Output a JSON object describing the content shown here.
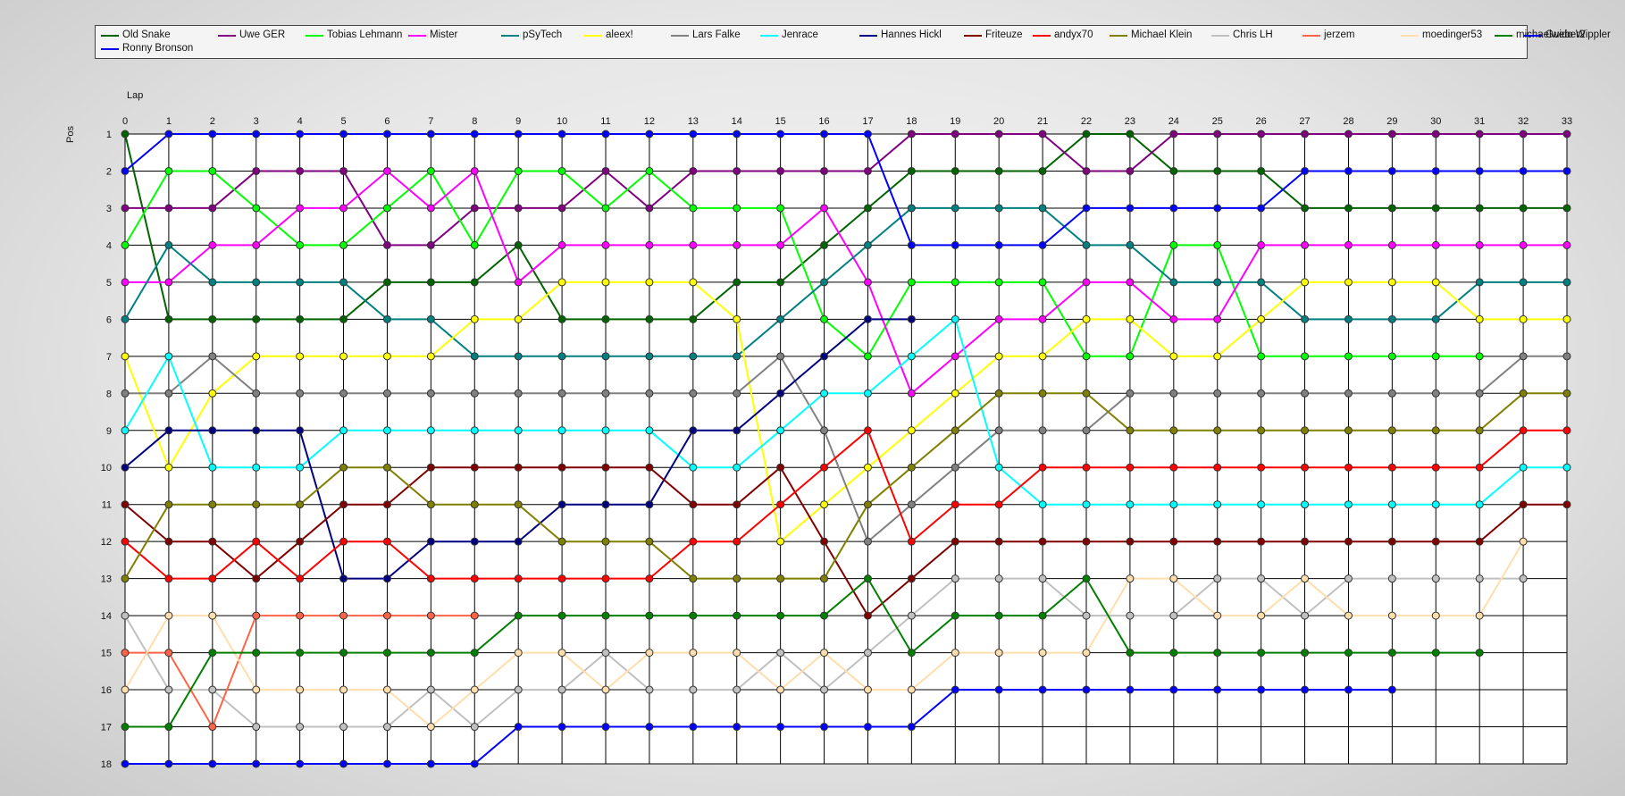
{
  "chart_data": {
    "type": "line",
    "xlabel": "Lap",
    "ylabel": "Pos",
    "x": [
      0,
      1,
      2,
      3,
      4,
      5,
      6,
      7,
      8,
      9,
      10,
      11,
      12,
      13,
      14,
      15,
      16,
      17,
      18,
      19,
      20,
      21,
      22,
      23,
      24,
      25,
      26,
      27,
      28,
      29,
      30,
      31,
      32,
      33
    ],
    "xlim": [
      0,
      33
    ],
    "ylim": [
      1,
      18
    ],
    "y_inverted": true,
    "grid": true,
    "legend_position": "top",
    "series": [
      {
        "name": "Old Snake",
        "color": "#006400",
        "values": [
          1,
          6,
          6,
          6,
          6,
          6,
          5,
          5,
          5,
          4,
          6,
          6,
          6,
          6,
          5,
          5,
          4,
          3,
          2,
          2,
          2,
          2,
          1,
          1,
          2,
          2,
          2,
          3,
          3,
          3,
          3,
          3,
          3,
          3
        ]
      },
      {
        "name": "Uwe GER",
        "color": "#800080",
        "values": [
          3,
          3,
          3,
          2,
          2,
          2,
          4,
          4,
          3,
          3,
          3,
          2,
          3,
          2,
          2,
          2,
          2,
          2,
          1,
          1,
          1,
          1,
          2,
          2,
          1,
          1,
          1,
          1,
          1,
          1,
          1,
          1,
          1,
          1
        ]
      },
      {
        "name": "Tobias Lehmann",
        "color": "#00ff00",
        "values": [
          4,
          2,
          2,
          3,
          4,
          4,
          3,
          2,
          4,
          2,
          2,
          3,
          2,
          3,
          3,
          3,
          6,
          7,
          5,
          5,
          5,
          5,
          7,
          7,
          4,
          4,
          7,
          7,
          7,
          7,
          7,
          7,
          null,
          null
        ]
      },
      {
        "name": "Mister",
        "color": "#ff00ff",
        "values": [
          5,
          5,
          4,
          4,
          3,
          3,
          2,
          3,
          2,
          5,
          4,
          4,
          4,
          4,
          4,
          4,
          3,
          5,
          8,
          7,
          6,
          6,
          5,
          5,
          6,
          6,
          4,
          4,
          4,
          4,
          4,
          4,
          4,
          4
        ]
      },
      {
        "name": "pSyTech",
        "color": "#008080",
        "values": [
          6,
          4,
          5,
          5,
          5,
          5,
          6,
          6,
          7,
          7,
          7,
          7,
          7,
          7,
          7,
          6,
          5,
          4,
          3,
          3,
          3,
          3,
          4,
          4,
          5,
          5,
          5,
          6,
          6,
          6,
          6,
          5,
          5,
          5
        ]
      },
      {
        "name": "aleex!",
        "color": "#ffff00",
        "values": [
          7,
          10,
          8,
          7,
          7,
          7,
          7,
          7,
          6,
          6,
          5,
          5,
          5,
          5,
          6,
          12,
          11,
          10,
          9,
          8,
          7,
          7,
          6,
          6,
          7,
          7,
          6,
          5,
          5,
          5,
          5,
          6,
          6,
          6
        ]
      },
      {
        "name": "Lars Falke",
        "color": "#808080",
        "values": [
          8,
          8,
          7,
          8,
          8,
          8,
          8,
          8,
          8,
          8,
          8,
          8,
          8,
          8,
          8,
          7,
          9,
          12,
          11,
          10,
          9,
          9,
          9,
          8,
          8,
          8,
          8,
          8,
          8,
          8,
          8,
          8,
          7,
          7
        ]
      },
      {
        "name": "Jenrace",
        "color": "#00ffff",
        "values": [
          9,
          7,
          10,
          10,
          10,
          9,
          9,
          9,
          9,
          9,
          9,
          9,
          9,
          10,
          10,
          9,
          8,
          8,
          7,
          6,
          10,
          11,
          11,
          11,
          11,
          11,
          11,
          11,
          11,
          11,
          11,
          11,
          10,
          10
        ]
      },
      {
        "name": "Hannes Hickl",
        "color": "#000080",
        "values": [
          10,
          9,
          9,
          9,
          9,
          13,
          13,
          12,
          12,
          12,
          11,
          11,
          11,
          9,
          9,
          8,
          7,
          6,
          6,
          null,
          null,
          null,
          null,
          null,
          null,
          null,
          null,
          null,
          null,
          null,
          null,
          null,
          null,
          null
        ]
      },
      {
        "name": "Friteuze",
        "color": "#800000",
        "values": [
          11,
          12,
          12,
          13,
          12,
          11,
          11,
          10,
          10,
          10,
          10,
          10,
          10,
          11,
          11,
          10,
          12,
          14,
          13,
          12,
          12,
          12,
          12,
          12,
          12,
          12,
          12,
          12,
          12,
          12,
          12,
          12,
          11,
          11
        ]
      },
      {
        "name": "andyx70",
        "color": "#ff0000",
        "values": [
          12,
          13,
          13,
          12,
          13,
          12,
          12,
          13,
          13,
          13,
          13,
          13,
          13,
          12,
          12,
          11,
          10,
          9,
          12,
          11,
          11,
          10,
          10,
          10,
          10,
          10,
          10,
          10,
          10,
          10,
          10,
          10,
          9,
          9
        ]
      },
      {
        "name": "Michael Klein",
        "color": "#808000",
        "values": [
          13,
          11,
          11,
          11,
          11,
          10,
          10,
          11,
          11,
          11,
          12,
          12,
          12,
          13,
          13,
          13,
          13,
          11,
          10,
          9,
          8,
          8,
          8,
          9,
          9,
          9,
          9,
          9,
          9,
          9,
          9,
          9,
          8,
          8
        ]
      },
      {
        "name": "Chris LH",
        "color": "#c0c0c0",
        "values": [
          14,
          16,
          16,
          17,
          17,
          17,
          17,
          16,
          17,
          16,
          16,
          15,
          16,
          16,
          16,
          15,
          16,
          15,
          14,
          13,
          13,
          13,
          14,
          14,
          14,
          13,
          13,
          14,
          13,
          13,
          13,
          13,
          13,
          null
        ]
      },
      {
        "name": "jerzem",
        "color": "#ff6347",
        "values": [
          15,
          15,
          17,
          14,
          14,
          14,
          14,
          14,
          14,
          null,
          null,
          null,
          null,
          null,
          null,
          null,
          null,
          null,
          null,
          null,
          null,
          null,
          null,
          null,
          null,
          null,
          null,
          null,
          null,
          null,
          null,
          null,
          null,
          null
        ]
      },
      {
        "name": "moedinger53",
        "color": "#ffdead",
        "values": [
          16,
          14,
          14,
          16,
          16,
          16,
          16,
          17,
          16,
          15,
          15,
          16,
          15,
          15,
          15,
          16,
          15,
          16,
          16,
          15,
          15,
          15,
          15,
          13,
          13,
          14,
          14,
          13,
          14,
          14,
          14,
          14,
          12,
          null
        ]
      },
      {
        "name": "michaelweber2",
        "color": "#008000",
        "values": [
          17,
          17,
          15,
          15,
          15,
          15,
          15,
          15,
          15,
          14,
          14,
          14,
          14,
          14,
          14,
          14,
          14,
          13,
          15,
          14,
          14,
          14,
          13,
          15,
          15,
          15,
          15,
          15,
          15,
          15,
          15,
          15,
          null,
          null
        ]
      },
      {
        "name": "Guido Wippler",
        "color": "#0000ff",
        "values": [
          18,
          18,
          18,
          18,
          18,
          18,
          18,
          18,
          18,
          17,
          17,
          17,
          17,
          17,
          17,
          17,
          17,
          17,
          17,
          16,
          16,
          16,
          16,
          16,
          16,
          16,
          16,
          16,
          16,
          16,
          null,
          null,
          null,
          null
        ]
      },
      {
        "name": "Ronny Bronson",
        "color": "#0000ff",
        "values": [
          2,
          1,
          1,
          1,
          1,
          1,
          1,
          1,
          1,
          1,
          1,
          1,
          1,
          1,
          1,
          1,
          1,
          1,
          4,
          4,
          4,
          4,
          3,
          3,
          3,
          3,
          3,
          2,
          2,
          2,
          2,
          2,
          2,
          2
        ]
      }
    ]
  }
}
